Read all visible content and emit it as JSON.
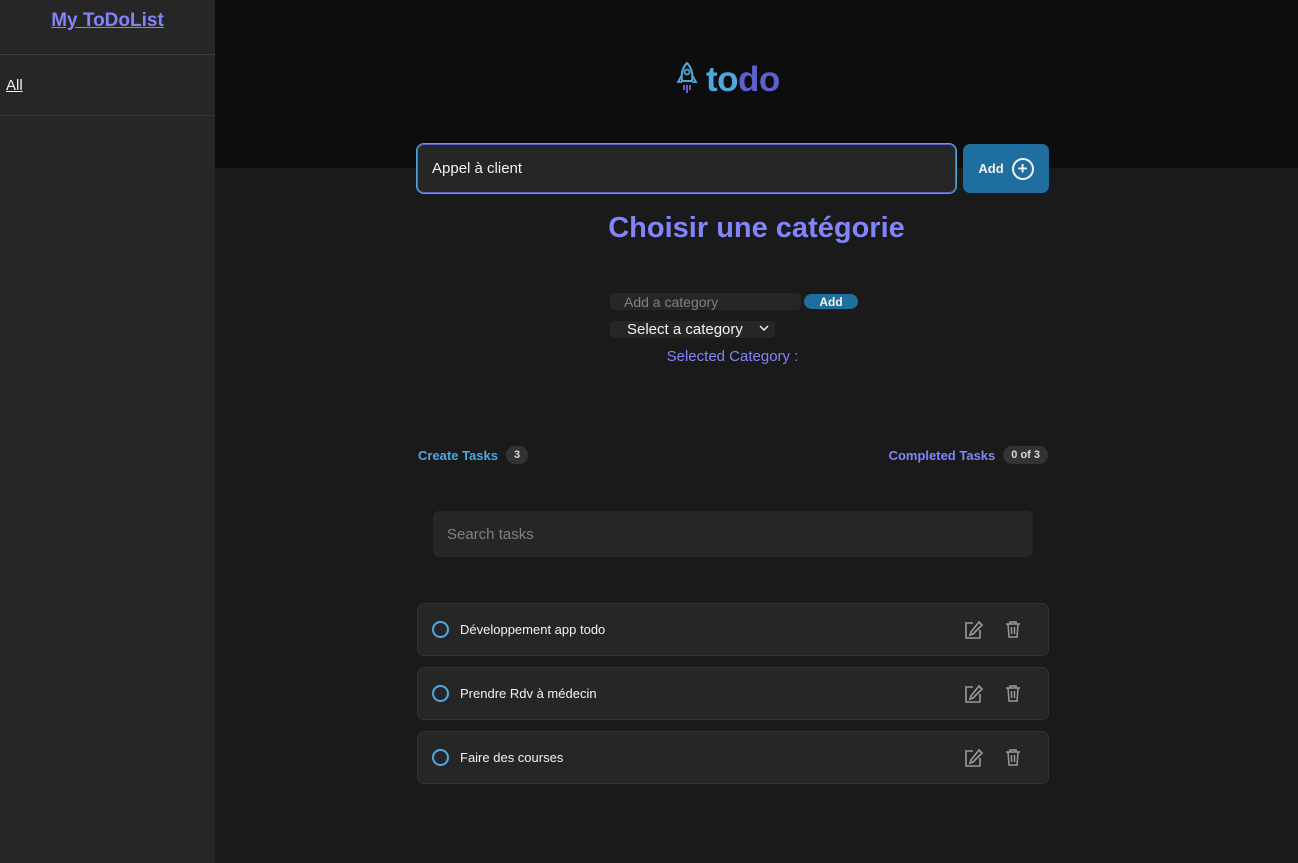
{
  "sidebar": {
    "title": "My ToDoList",
    "items": [
      {
        "label": "All"
      }
    ]
  },
  "header": {
    "logo_part1": "to",
    "logo_part2": "do",
    "logo_icon": "rocket-icon"
  },
  "new_task": {
    "value": "Appel à client",
    "add_label": "Add",
    "add_icon": "plus-circle-icon"
  },
  "category": {
    "heading": "Choisir une catégorie",
    "input_placeholder": "Add a category",
    "add_label": "Add",
    "select_value": "Select a category",
    "selected_label": "Selected Category :"
  },
  "counters": {
    "created_label": "Create Tasks",
    "created_count": "3",
    "completed_label": "Completed Tasks",
    "completed_count": "0 of 3"
  },
  "search": {
    "placeholder": "Search tasks"
  },
  "tasks": [
    {
      "text": "Développement app todo",
      "done": false
    },
    {
      "text": "Prendre Rdv à médecin",
      "done": false
    },
    {
      "text": "Faire des courses",
      "done": false
    }
  ],
  "colors": {
    "accent_blue": "#4ea8de",
    "accent_purple": "#8284fa",
    "button_blue": "#1e6f9f",
    "background": "#1a1a1a"
  }
}
